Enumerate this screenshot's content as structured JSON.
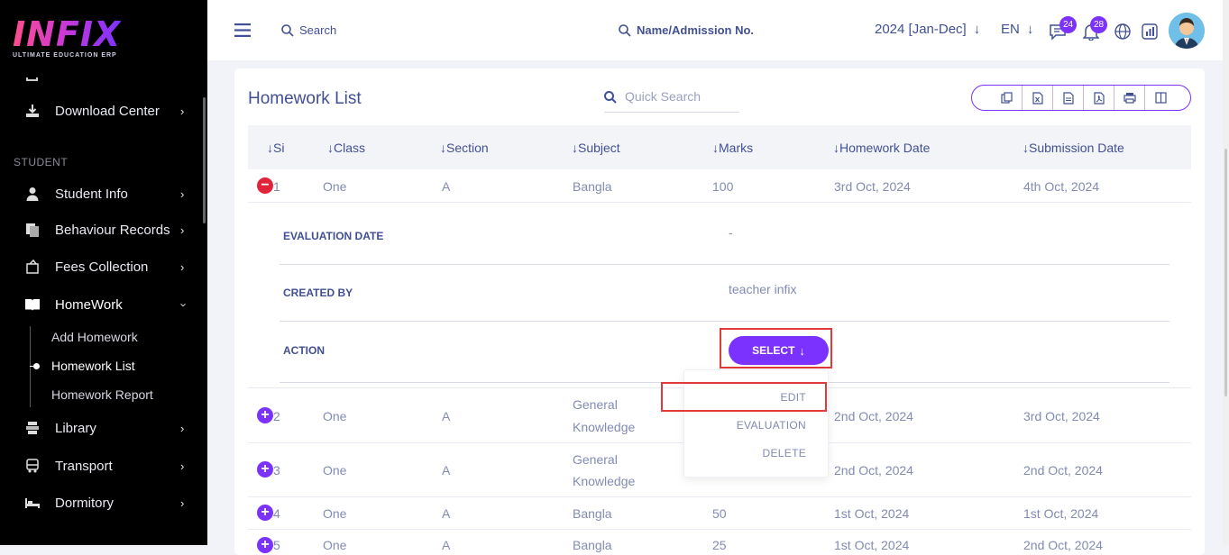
{
  "brand": {
    "logo": "INFIX",
    "tagline": "ULTIMATE EDUCATION ERP"
  },
  "sidebar": {
    "items": [
      {
        "label": "Download Center",
        "icon": "download-icon"
      },
      {
        "label": "Student Info",
        "icon": "student-icon"
      },
      {
        "label": "Behaviour Records",
        "icon": "behaviour-icon"
      },
      {
        "label": "Fees Collection",
        "icon": "fees-icon"
      },
      {
        "label": "HomeWork",
        "icon": "book-icon"
      },
      {
        "label": "Library",
        "icon": "library-icon"
      },
      {
        "label": "Transport",
        "icon": "bus-icon"
      },
      {
        "label": "Dormitory",
        "icon": "bed-icon"
      }
    ],
    "section_label": "STUDENT",
    "homework_sub": [
      "Add Homework",
      "Homework List",
      "Homework Report"
    ]
  },
  "topbar": {
    "search_label": "Search",
    "admission_search_label": "Name/Admission No.",
    "session": "2024 [Jan-Dec]",
    "language": "EN",
    "messages_count": "24",
    "notifications_count": "28"
  },
  "page": {
    "title": "Homework List",
    "quick_search_placeholder": "Quick Search"
  },
  "table": {
    "columns": [
      "Si",
      "Class",
      "Section",
      "Subject",
      "Marks",
      "Homework Date",
      "Submission Date"
    ],
    "rows": [
      {
        "si": "1",
        "class": "One",
        "section": "A",
        "subject": "Bangla",
        "marks": "100",
        "homework_date": "3rd Oct, 2024",
        "submission_date": "4th Oct, 2024"
      },
      {
        "si": "2",
        "class": "One",
        "section": "A",
        "subject_line1": "General",
        "subject_line2": "Knowledge",
        "marks": "",
        "homework_date": "2nd Oct, 2024",
        "submission_date": "3rd Oct, 2024"
      },
      {
        "si": "3",
        "class": "One",
        "section": "A",
        "subject_line1": "General",
        "subject_line2": "Knowledge",
        "marks": "",
        "homework_date": "2nd Oct, 2024",
        "submission_date": "2nd Oct, 2024"
      },
      {
        "si": "4",
        "class": "One",
        "section": "A",
        "subject": "Bangla",
        "marks": "50",
        "homework_date": "1st Oct, 2024",
        "submission_date": "1st Oct, 2024"
      },
      {
        "si": "5",
        "class": "One",
        "section": "A",
        "subject": "Bangla",
        "marks": "25",
        "homework_date": "1st Oct, 2024",
        "submission_date": "2nd Oct, 2024"
      }
    ]
  },
  "details": {
    "evaluation_date_label": "EVALUATION DATE",
    "evaluation_date_value": "-",
    "created_by_label": "CREATED BY",
    "created_by_value": "teacher infix",
    "action_label": "ACTION",
    "select_label": "SELECT"
  },
  "action_menu": [
    "EDIT",
    "EVALUATION",
    "DELETE"
  ],
  "colors": {
    "accent": "#7c32ff",
    "highlight": "#e03a3a",
    "text": "#415094",
    "muted": "#828bb2"
  }
}
